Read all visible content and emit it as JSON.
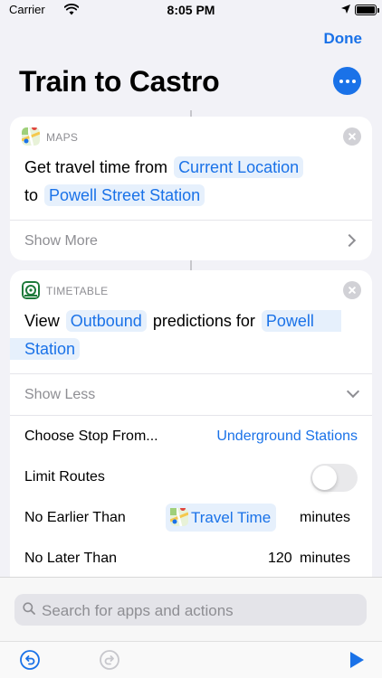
{
  "status_bar": {
    "carrier": "Carrier",
    "time": "8:05 PM"
  },
  "header": {
    "done_label": "Done",
    "title": "Train to Castro"
  },
  "maps_card": {
    "app_name": "MAPS",
    "action_prefix": "Get travel time from",
    "origin": "Current Location",
    "to_word": "to",
    "destination": "Powell Street Station",
    "show_more_label": "Show More"
  },
  "timetable_card": {
    "app_name": "TIMETABLE",
    "action_prefix": "View",
    "direction": "Outbound",
    "predictions_word": "predictions for",
    "station_line1": "Powell",
    "station_line2": "Station",
    "show_less_label": "Show Less",
    "choose_stop_label": "Choose Stop From...",
    "choose_stop_value": "Underground Stations",
    "limit_routes_label": "Limit Routes",
    "limit_routes_on": false,
    "no_earlier_label": "No Earlier Than",
    "no_earlier_value": "Travel Time",
    "no_earlier_unit": "minutes",
    "no_later_label": "No Later Than",
    "no_later_value": "120",
    "no_later_unit": "minutes"
  },
  "search": {
    "placeholder": "Search for apps and actions"
  },
  "toolbar": {
    "undo_icon": "undo-icon",
    "redo_icon": "redo-icon",
    "run_icon": "play-icon"
  },
  "colors": {
    "accent": "#1a72e8",
    "background": "#f2f2f7",
    "token_bg": "#e6f0fc"
  }
}
